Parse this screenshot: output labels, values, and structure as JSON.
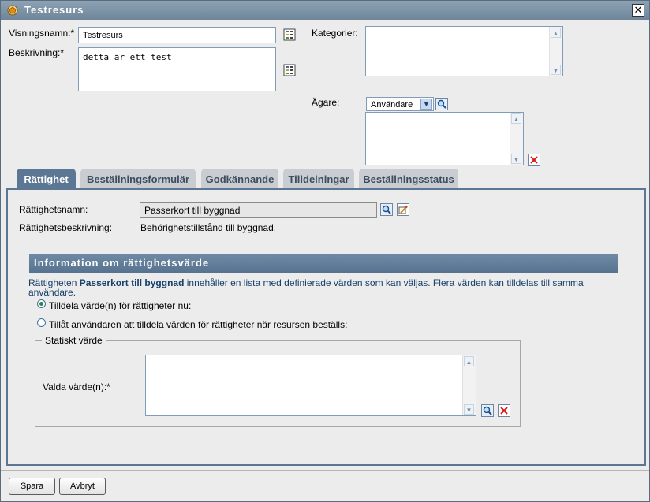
{
  "window": {
    "title": "Testresurs",
    "close_label": "✕"
  },
  "form": {
    "display_name_label": "Visningsnamn:*",
    "display_name_value": "Testresurs",
    "description_label": "Beskrivning:*",
    "description_value": "detta är ett test",
    "categories_label": "Kategorier:",
    "owner_label": "Ägare:",
    "owner_type_selected": "Användare"
  },
  "tabs": [
    {
      "label": "Rättighet",
      "active": true
    },
    {
      "label": "Beställningsformulär",
      "active": false
    },
    {
      "label": "Godkännande",
      "active": false
    },
    {
      "label": "Tilldelningar",
      "active": false
    },
    {
      "label": "Beställningsstatus",
      "active": false
    }
  ],
  "entitlement": {
    "name_label": "Rättighetsnamn:",
    "name_value": "Passerkort till byggnad",
    "description_label": "Rättighetsbeskrivning:",
    "description_value": "Behörighetstillstånd till byggnad."
  },
  "section": {
    "title": "Information om rättighetsvärde",
    "info_prefix": "Rättigheten ",
    "info_bold": "Passerkort till byggnad",
    "info_rest": " innehåller en lista med definierade värden som kan väljas. Flera värden kan tilldelas till samma",
    "info_line2": "användare.",
    "radio_assign_now": "Tilldela värde(n) för rättigheter nu:",
    "radio_allow_user": "Tillåt användaren att tilldela värden för rättigheter när resursen beställs:",
    "static_value_legend": "Statiskt värde",
    "selected_values_label": "Valda värde(n):*"
  },
  "buttons": {
    "save": "Spara",
    "cancel": "Avbryt"
  },
  "colors": {
    "tab_active": "#5b7793",
    "section_header": "#6f8aa5",
    "titlebar": "#8da2b3"
  }
}
